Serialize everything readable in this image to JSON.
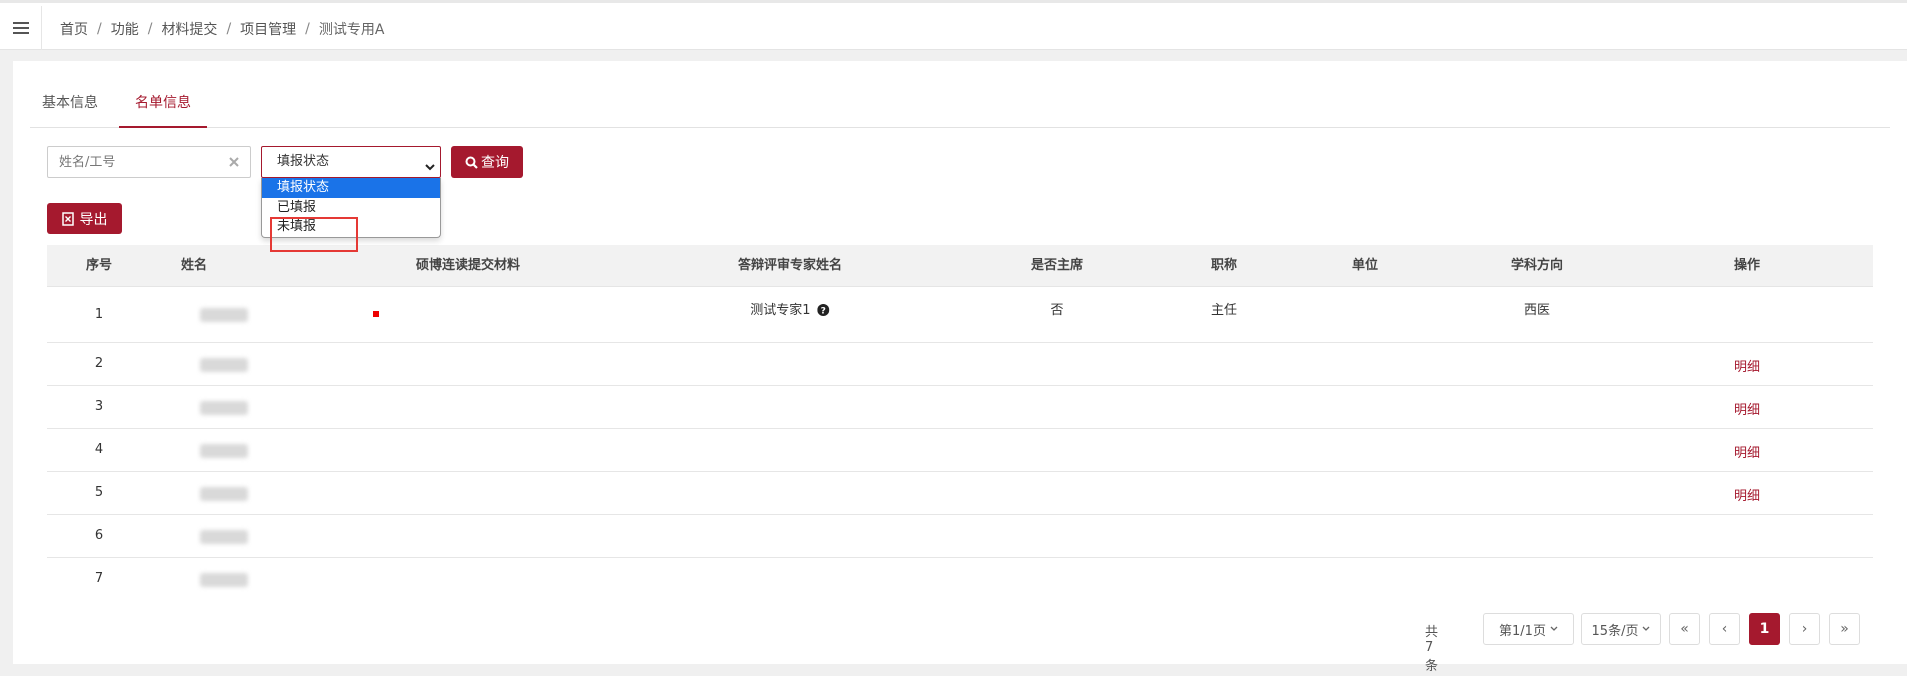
{
  "breadcrumb": [
    "首页",
    "功能",
    "材料提交",
    "项目管理",
    "测试专用A"
  ],
  "tabs": [
    {
      "label": "基本信息"
    },
    {
      "label": "名单信息"
    }
  ],
  "filters": {
    "search_placeholder": "姓名/工号",
    "status_selected": "填报状态",
    "status_options": [
      "填报状态",
      "已填报",
      "未填报"
    ],
    "query_label": "查询"
  },
  "toolbar": {
    "export_label": "导出"
  },
  "table": {
    "headers": [
      "序号",
      "姓名",
      "硕博连读提交材料",
      "答辩评审专家姓名",
      "是否主席",
      "职称",
      "单位",
      "学科方向",
      "操作"
    ],
    "rows": [
      {
        "index": "1",
        "expert": "测试专家1",
        "chair": "否",
        "title": "主任",
        "unit": "",
        "direction": "西医",
        "action": ""
      },
      {
        "index": "2",
        "expert": "",
        "chair": "",
        "title": "",
        "unit": "",
        "direction": "",
        "action": "明细"
      },
      {
        "index": "3",
        "expert": "",
        "chair": "",
        "title": "",
        "unit": "",
        "direction": "",
        "action": "明细"
      },
      {
        "index": "4",
        "expert": "",
        "chair": "",
        "title": "",
        "unit": "",
        "direction": "",
        "action": "明细"
      },
      {
        "index": "5",
        "expert": "",
        "chair": "",
        "title": "",
        "unit": "",
        "direction": "",
        "action": "明细"
      },
      {
        "index": "6",
        "expert": "",
        "chair": "",
        "title": "",
        "unit": "",
        "direction": "",
        "action": ""
      },
      {
        "index": "7",
        "expert": "",
        "chair": "",
        "title": "",
        "unit": "",
        "direction": "",
        "action": ""
      }
    ]
  },
  "pagination": {
    "total": "共7条",
    "page_select": "第1/1页",
    "size_select": "15条/页",
    "first": "«",
    "prev": "‹",
    "current": "1",
    "next": "›",
    "last": "»"
  },
  "colors": {
    "accent": "#a5192e",
    "dropdown_highlight": "#1a73e8",
    "annotation": "#e53935"
  },
  "icons": [
    "menu-icon",
    "clear-icon",
    "chevron-down-icon",
    "search-icon",
    "export-file-icon",
    "help-circle-icon"
  ]
}
